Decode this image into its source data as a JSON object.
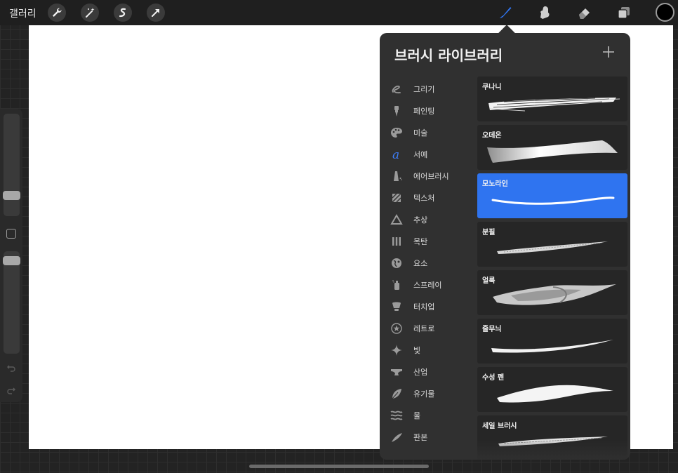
{
  "topbar": {
    "gallery_label": "갤러리",
    "left_tools": [
      "wrench-icon",
      "magic-wand-icon",
      "selection-icon",
      "transform-arrow-icon"
    ],
    "right_tools": [
      "brush-icon",
      "smudge-icon",
      "eraser-icon",
      "layers-icon"
    ],
    "active_tool": "brush-icon",
    "active_color": "#000000",
    "accent": "#2f74f0"
  },
  "sidebar": {
    "size_slider_level": 0.17,
    "opacity_slider_level": 0.95
  },
  "panel": {
    "title": "브러시 라이브러리",
    "add_label": "+",
    "categories": [
      {
        "label": "그리기",
        "icon": "sketch-squiggle-icon"
      },
      {
        "label": "페인팅",
        "icon": "paint-brush-icon"
      },
      {
        "label": "미술",
        "icon": "palette-icon"
      },
      {
        "label": "서예",
        "icon": "calligraphy-a-icon"
      },
      {
        "label": "에어브러시",
        "icon": "airbrush-icon"
      },
      {
        "label": "텍스처",
        "icon": "texture-icon"
      },
      {
        "label": "추상",
        "icon": "triangle-icon"
      },
      {
        "label": "목탄",
        "icon": "charcoal-icon"
      },
      {
        "label": "요소",
        "icon": "globe-icon"
      },
      {
        "label": "스프레이",
        "icon": "spray-can-icon"
      },
      {
        "label": "터치업",
        "icon": "lightbulb-icon"
      },
      {
        "label": "레트로",
        "icon": "retro-star-icon"
      },
      {
        "label": "빛",
        "icon": "sparkle-icon"
      },
      {
        "label": "산업",
        "icon": "anvil-icon"
      },
      {
        "label": "유기물",
        "icon": "leaf-icon"
      },
      {
        "label": "물",
        "icon": "waves-icon"
      },
      {
        "label": "판본",
        "icon": "feather-icon"
      }
    ],
    "selected_category": "서예",
    "brushes": [
      {
        "name": "쿠나니"
      },
      {
        "name": "오데온"
      },
      {
        "name": "모노라인"
      },
      {
        "name": "분필"
      },
      {
        "name": "얼룩"
      },
      {
        "name": "줄무늬"
      },
      {
        "name": "수성 펜"
      },
      {
        "name": "세일 브러시"
      }
    ],
    "selected_brush": "모노라인"
  }
}
